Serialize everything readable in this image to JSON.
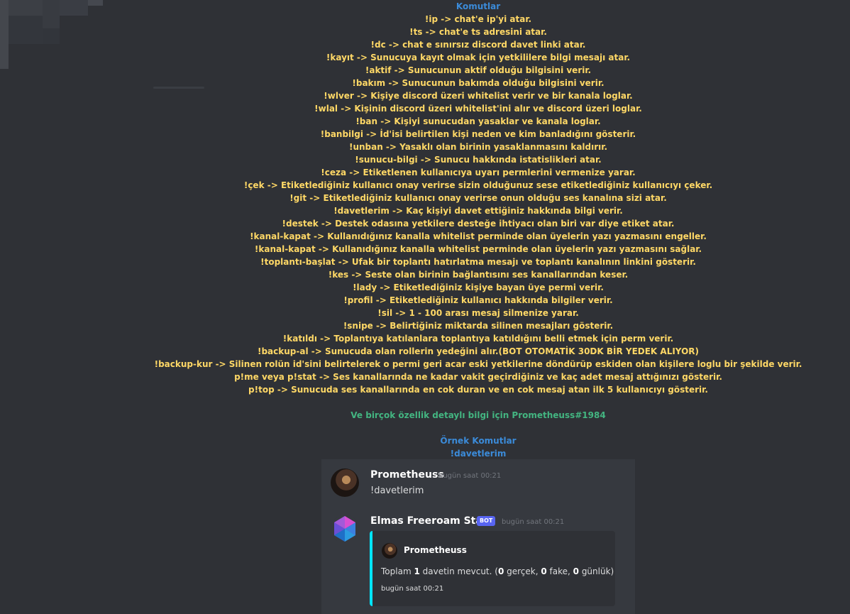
{
  "colors": {
    "background": "#2f3136",
    "chat_background": "#36393f",
    "title_blue": "#3b8bd9",
    "command_yellow": "#ffd866",
    "credit_green": "#43b581",
    "embed_accent": "#00e5ff",
    "bot_badge": "#5865f2"
  },
  "commands_block": {
    "title": "Komutlar",
    "lines": [
      "!ip -> chat'e ip'yi atar.",
      "!ts -> chat'e ts adresini atar.",
      "!dc -> chat e sınırsız discord davet linki atar.",
      "!kayıt -> Sunucuya kayıt olmak için yetkililere bilgi mesajı atar.",
      "!aktif -> Sunucunun aktif olduğu bilgisini verir.",
      "!bakım -> Sunucunun bakımda olduğu bilgisini verir.",
      "!wlver -> Kişiye discord üzeri whitelist verir ve bir kanala loglar.",
      "!wlal -> Kişinin discord üzeri whitelist'ini alır ve discord üzeri loglar.",
      "!ban -> Kişiyi sunucudan yasaklar ve kanala loglar.",
      "!banbilgi -> İd'isi belirtilen kişi neden ve kim banladığını gösterir.",
      "!unban -> Yasaklı olan birinin yasaklanmasını kaldırır.",
      "!sunucu-bilgi -> Sunucu hakkında istatislikleri atar.",
      "!ceza -> Etiketlenen kullanıcıya uyarı permlerini vermenize yarar.",
      "!çek -> Etiketlediğiniz kullanıcı onay verirse sizin olduğunuz sese etiketlediğiniz kullanıcıyı çeker.",
      "!git -> Etiketlediğiniz kullanıcı onay verirse onun olduğu ses kanalına sizi atar.",
      "!davetlerim -> Kaç kişiyi davet ettiğiniz hakkında bilgi verir.",
      "!destek -> Destek odasına yetkilere desteğe ihtiyacı olan biri var diye etiket atar.",
      "!kanal-kapat -> Kullanıdığınız kanalla whitelist perminde olan üyelerin yazı yazmasını engeller.",
      "!kanal-kapat -> Kullanıdığınız kanalla whitelist perminde olan üyelerin yazı yazmasını sağlar.",
      "!toplantı-başlat -> Ufak bir toplantı hatırlatma mesajı ve toplantı kanalının linkini gösterir.",
      "!kes -> Seste olan birinin bağlantısını ses kanallarından keser.",
      "!lady -> Etiketlediğiniz kişiye bayan üye permi verir.",
      "!profil -> Etiketlediğiniz kullanıcı hakkında bilgiler verir.",
      "!sil -> 1 - 100 arası mesaj silmenize yarar.",
      "!snipe -> Belirtiğiniz miktarda silinen mesajları gösterir.",
      "!katıldı -> Toplantıya katılanlara toplantıya katıldığını belli etmek için perm verir.",
      "!backup-al -> Sunucuda olan rollerin yedeğini alır.(BOT OTOMATİK 30DK BİR YEDEK ALIYOR)",
      "!backup-kur -> Silinen rolün id'sini belirtelerek o permi geri acar eski yetkilerine döndürüp eskiden olan kişilere loglu bir şekilde verir.",
      "p!me veya p!stat -> Ses kanallarında ne kadar vakit geçirdiğiniz ve kaç adet mesaj attığınızı gösterir.",
      "p!top -> Sunucuda ses kanallarında en cok duran ve en cok mesaj atan ilk 5 kullanıcıyı gösterir."
    ],
    "credit": "Ve birçok özellik detaylı bilgi için Prometheuss#1984",
    "example_title": "Örnek Komutlar",
    "example_command": "!davetlerim"
  },
  "chat": {
    "message1": {
      "username": "Prometheuss",
      "timestamp": "bugün saat 00:21",
      "text": "!davetlerim"
    },
    "message2": {
      "username": "Elmas Freeroam Stats",
      "badge": "BOT",
      "timestamp": "bugün saat 00:21",
      "embed": {
        "author": "Prometheuss",
        "desc_prefix": "Toplam ",
        "total": "1",
        "desc_mid1": " davetin mevcut. (",
        "real": "0",
        "desc_mid2": " gerçek, ",
        "fake": "0",
        "desc_mid3": " fake, ",
        "daily": "0",
        "desc_suffix": " günlük)",
        "footer": "bugün saat 00:21"
      }
    }
  }
}
